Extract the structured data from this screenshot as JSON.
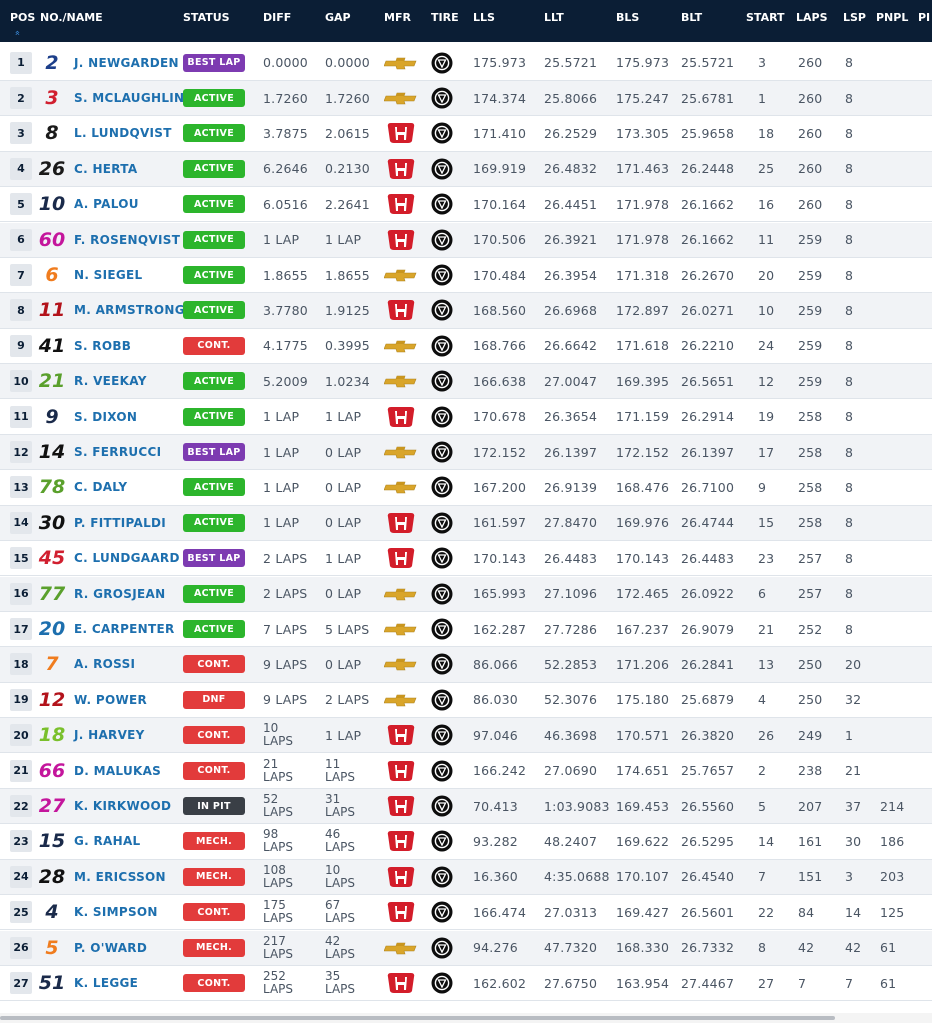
{
  "colors": {
    "header_bg": "#0b1e35",
    "best_lap": "#7d3bb1",
    "active": "#2cb52c",
    "cont": "#e23b3b",
    "dnf": "#e23b3b",
    "in_pit": "#3a3f46",
    "mech": "#e23b3b",
    "link": "#1d6fae"
  },
  "columns": [
    "POS",
    "NO./NAME",
    "STATUS",
    "DIFF",
    "GAP",
    "MFR",
    "TIRE",
    "LLS",
    "LLT",
    "BLS",
    "BLT",
    "START",
    "LAPS",
    "LSP",
    "PNPL",
    "PI"
  ],
  "sort_icon": "chevron-double-up-icon",
  "rows": [
    {
      "pos": "1",
      "num": "2",
      "num_color": "#1d3f8a",
      "name": "J. NEWGARDEN",
      "status": "BEST LAP",
      "status_type": "best_lap",
      "diff": "0.0000",
      "gap": "0.0000",
      "mfr": "chevrolet",
      "lls": "175.973",
      "llt": "25.5721",
      "bls": "175.973",
      "blt": "25.5721",
      "start": "3",
      "laps": "260",
      "lsp": "8",
      "pnpl": ""
    },
    {
      "pos": "2",
      "num": "3",
      "num_color": "#d11f2f",
      "name": "S. MCLAUGHLIN",
      "status": "ACTIVE",
      "status_type": "active",
      "diff": "1.7260",
      "gap": "1.7260",
      "mfr": "chevrolet",
      "lls": "174.374",
      "llt": "25.8066",
      "bls": "175.247",
      "blt": "25.6781",
      "start": "1",
      "laps": "260",
      "lsp": "8",
      "pnpl": ""
    },
    {
      "pos": "3",
      "num": "8",
      "num_color": "#1a1a1a",
      "name": "L. LUNDQVIST",
      "status": "ACTIVE",
      "status_type": "active",
      "diff": "3.7875",
      "gap": "2.0615",
      "mfr": "honda",
      "lls": "171.410",
      "llt": "26.2529",
      "bls": "173.305",
      "blt": "25.9658",
      "start": "18",
      "laps": "260",
      "lsp": "8",
      "pnpl": ""
    },
    {
      "pos": "4",
      "num": "26",
      "num_color": "#1a1a1a",
      "name": "C. HERTA",
      "status": "ACTIVE",
      "status_type": "active",
      "diff": "6.2646",
      "gap": "0.2130",
      "mfr": "honda",
      "lls": "169.919",
      "llt": "26.4832",
      "bls": "171.463",
      "blt": "26.2448",
      "start": "25",
      "laps": "260",
      "lsp": "8",
      "pnpl": ""
    },
    {
      "pos": "5",
      "num": "10",
      "num_color": "#1a2a4a",
      "name": "A. PALOU",
      "status": "ACTIVE",
      "status_type": "active",
      "diff": "6.0516",
      "gap": "2.2641",
      "mfr": "honda",
      "lls": "170.164",
      "llt": "26.4451",
      "bls": "171.978",
      "blt": "26.1662",
      "start": "16",
      "laps": "260",
      "lsp": "8",
      "pnpl": ""
    },
    {
      "pos": "6",
      "num": "60",
      "num_color": "#c4169c",
      "name": "F. ROSENQVIST",
      "status": "ACTIVE",
      "status_type": "active",
      "diff": "1 LAP",
      "gap": "1 LAP",
      "mfr": "honda",
      "lls": "170.506",
      "llt": "26.3921",
      "bls": "171.978",
      "blt": "26.1662",
      "start": "11",
      "laps": "259",
      "lsp": "8",
      "pnpl": ""
    },
    {
      "pos": "7",
      "num": "6",
      "num_color": "#f07c1e",
      "name": "N. SIEGEL",
      "status": "ACTIVE",
      "status_type": "active",
      "diff": "1.8655",
      "gap": "1.8655",
      "mfr": "chevrolet",
      "lls": "170.484",
      "llt": "26.3954",
      "bls": "171.318",
      "blt": "26.2670",
      "start": "20",
      "laps": "259",
      "lsp": "8",
      "pnpl": ""
    },
    {
      "pos": "8",
      "num": "11",
      "num_color": "#b3131b",
      "name": "M. ARMSTRONG",
      "status": "ACTIVE",
      "status_type": "active",
      "diff": "3.7780",
      "gap": "1.9125",
      "mfr": "honda",
      "lls": "168.560",
      "llt": "26.6968",
      "bls": "172.897",
      "blt": "26.0271",
      "start": "10",
      "laps": "259",
      "lsp": "8",
      "pnpl": ""
    },
    {
      "pos": "9",
      "num": "41",
      "num_color": "#111111",
      "name": "S. ROBB",
      "status": "CONT.",
      "status_type": "cont",
      "diff": "4.1775",
      "gap": "0.3995",
      "mfr": "chevrolet",
      "lls": "168.766",
      "llt": "26.6642",
      "bls": "171.618",
      "blt": "26.2210",
      "start": "24",
      "laps": "259",
      "lsp": "8",
      "pnpl": ""
    },
    {
      "pos": "10",
      "num": "21",
      "num_color": "#5aa02c",
      "name": "R. VEEKAY",
      "status": "ACTIVE",
      "status_type": "active",
      "diff": "5.2009",
      "gap": "1.0234",
      "mfr": "chevrolet",
      "lls": "166.638",
      "llt": "27.0047",
      "bls": "169.395",
      "blt": "26.5651",
      "start": "12",
      "laps": "259",
      "lsp": "8",
      "pnpl": ""
    },
    {
      "pos": "11",
      "num": "9",
      "num_color": "#1a2a4a",
      "name": "S. DIXON",
      "status": "ACTIVE",
      "status_type": "active",
      "diff": "1 LAP",
      "gap": "1 LAP",
      "mfr": "honda",
      "lls": "170.678",
      "llt": "26.3654",
      "bls": "171.159",
      "blt": "26.2914",
      "start": "19",
      "laps": "258",
      "lsp": "8",
      "pnpl": ""
    },
    {
      "pos": "12",
      "num": "14",
      "num_color": "#111111",
      "name": "S. FERRUCCI",
      "status": "BEST LAP",
      "status_type": "best_lap",
      "diff": "1 LAP",
      "gap": "0 LAP",
      "mfr": "chevrolet",
      "lls": "172.152",
      "llt": "26.1397",
      "bls": "172.152",
      "blt": "26.1397",
      "start": "17",
      "laps": "258",
      "lsp": "8",
      "pnpl": ""
    },
    {
      "pos": "13",
      "num": "78",
      "num_color": "#5aa02c",
      "name": "C. DALY",
      "status": "ACTIVE",
      "status_type": "active",
      "diff": "1 LAP",
      "gap": "0 LAP",
      "mfr": "chevrolet",
      "lls": "167.200",
      "llt": "26.9139",
      "bls": "168.476",
      "blt": "26.7100",
      "start": "9",
      "laps": "258",
      "lsp": "8",
      "pnpl": ""
    },
    {
      "pos": "14",
      "num": "30",
      "num_color": "#111111",
      "name": "P. FITTIPALDI",
      "status": "ACTIVE",
      "status_type": "active",
      "diff": "1 LAP",
      "gap": "0 LAP",
      "mfr": "honda",
      "lls": "161.597",
      "llt": "27.8470",
      "bls": "169.976",
      "blt": "26.4744",
      "start": "15",
      "laps": "258",
      "lsp": "8",
      "pnpl": ""
    },
    {
      "pos": "15",
      "num": "45",
      "num_color": "#d11f2f",
      "name": "C. LUNDGAARD",
      "status": "BEST LAP",
      "status_type": "best_lap",
      "diff": "2 LAPS",
      "gap": "1 LAP",
      "mfr": "honda",
      "lls": "170.143",
      "llt": "26.4483",
      "bls": "170.143",
      "blt": "26.4483",
      "start": "23",
      "laps": "257",
      "lsp": "8",
      "pnpl": ""
    },
    {
      "pos": "16",
      "num": "77",
      "num_color": "#5aa02c",
      "name": "R. GROSJEAN",
      "status": "ACTIVE",
      "status_type": "active",
      "diff": "2 LAPS",
      "gap": "0 LAP",
      "mfr": "chevrolet",
      "lls": "165.993",
      "llt": "27.1096",
      "bls": "172.465",
      "blt": "26.0922",
      "start": "6",
      "laps": "257",
      "lsp": "8",
      "pnpl": ""
    },
    {
      "pos": "17",
      "num": "20",
      "num_color": "#1d6fae",
      "name": "E. CARPENTER",
      "status": "ACTIVE",
      "status_type": "active",
      "diff": "7 LAPS",
      "gap": "5 LAPS",
      "mfr": "chevrolet",
      "lls": "162.287",
      "llt": "27.7286",
      "bls": "167.237",
      "blt": "26.9079",
      "start": "21",
      "laps": "252",
      "lsp": "8",
      "pnpl": ""
    },
    {
      "pos": "18",
      "num": "7",
      "num_color": "#f07c1e",
      "name": "A. ROSSI",
      "status": "CONT.",
      "status_type": "cont",
      "diff": "9 LAPS",
      "gap": "0 LAP",
      "mfr": "chevrolet",
      "lls": "86.066",
      "llt": "52.2853",
      "bls": "171.206",
      "blt": "26.2841",
      "start": "13",
      "laps": "250",
      "lsp": "20",
      "pnpl": ""
    },
    {
      "pos": "19",
      "num": "12",
      "num_color": "#b3131b",
      "name": "W. POWER",
      "status": "DNF",
      "status_type": "dnf",
      "diff": "9 LAPS",
      "gap": "2 LAPS",
      "mfr": "chevrolet",
      "lls": "86.030",
      "llt": "52.3076",
      "bls": "175.180",
      "blt": "25.6879",
      "start": "4",
      "laps": "250",
      "lsp": "32",
      "pnpl": ""
    },
    {
      "pos": "20",
      "num": "18",
      "num_color": "#7ac02c",
      "name": "J. HARVEY",
      "status": "CONT.",
      "status_type": "cont",
      "diff": "10 LAPS",
      "gap": "1 LAP",
      "mfr": "honda",
      "lls": "97.046",
      "llt": "46.3698",
      "bls": "170.571",
      "blt": "26.3820",
      "start": "26",
      "laps": "249",
      "lsp": "1",
      "pnpl": ""
    },
    {
      "pos": "21",
      "num": "66",
      "num_color": "#c4169c",
      "name": "D. MALUKAS",
      "status": "CONT.",
      "status_type": "cont",
      "diff": "21 LAPS",
      "gap": "11 LAPS",
      "mfr": "honda",
      "lls": "166.242",
      "llt": "27.0690",
      "bls": "174.651",
      "blt": "25.7657",
      "start": "2",
      "laps": "238",
      "lsp": "21",
      "pnpl": ""
    },
    {
      "pos": "22",
      "num": "27",
      "num_color": "#c4169c",
      "name": "K. KIRKWOOD",
      "status": "IN PIT",
      "status_type": "in_pit",
      "diff": "52 LAPS",
      "gap": "31 LAPS",
      "mfr": "honda",
      "lls": "70.413",
      "llt": "1:03.9083",
      "bls": "169.453",
      "blt": "26.5560",
      "start": "5",
      "laps": "207",
      "lsp": "37",
      "pnpl": "214"
    },
    {
      "pos": "23",
      "num": "15",
      "num_color": "#1a2a4a",
      "name": "G. RAHAL",
      "status": "MECH.",
      "status_type": "mech",
      "diff": "98 LAPS",
      "gap": "46 LAPS",
      "mfr": "honda",
      "lls": "93.282",
      "llt": "48.2407",
      "bls": "169.622",
      "blt": "26.5295",
      "start": "14",
      "laps": "161",
      "lsp": "30",
      "pnpl": "186"
    },
    {
      "pos": "24",
      "num": "28",
      "num_color": "#111111",
      "name": "M. ERICSSON",
      "status": "MECH.",
      "status_type": "mech",
      "diff": "108 LAPS",
      "gap": "10 LAPS",
      "mfr": "honda",
      "lls": "16.360",
      "llt": "4:35.0688",
      "bls": "170.107",
      "blt": "26.4540",
      "start": "7",
      "laps": "151",
      "lsp": "3",
      "pnpl": "203"
    },
    {
      "pos": "25",
      "num": "4",
      "num_color": "#1a2a4a",
      "name": "K. SIMPSON",
      "status": "CONT.",
      "status_type": "cont",
      "diff": "175 LAPS",
      "gap": "67 LAPS",
      "mfr": "honda",
      "lls": "166.474",
      "llt": "27.0313",
      "bls": "169.427",
      "blt": "26.5601",
      "start": "22",
      "laps": "84",
      "lsp": "14",
      "pnpl": "125"
    },
    {
      "pos": "26",
      "num": "5",
      "num_color": "#f07c1e",
      "name": "P. O'WARD",
      "status": "MECH.",
      "status_type": "mech",
      "diff": "217 LAPS",
      "gap": "42 LAPS",
      "mfr": "chevrolet",
      "lls": "94.276",
      "llt": "47.7320",
      "bls": "168.330",
      "blt": "26.7332",
      "start": "8",
      "laps": "42",
      "lsp": "42",
      "pnpl": "61"
    },
    {
      "pos": "27",
      "num": "51",
      "num_color": "#1a2a4a",
      "name": "K. LEGGE",
      "status": "CONT.",
      "status_type": "cont",
      "diff": "252 LAPS",
      "gap": "35 LAPS",
      "mfr": "honda",
      "lls": "162.602",
      "llt": "27.6750",
      "bls": "163.954",
      "blt": "27.4467",
      "start": "27",
      "laps": "7",
      "lsp": "7",
      "pnpl": "61"
    }
  ]
}
